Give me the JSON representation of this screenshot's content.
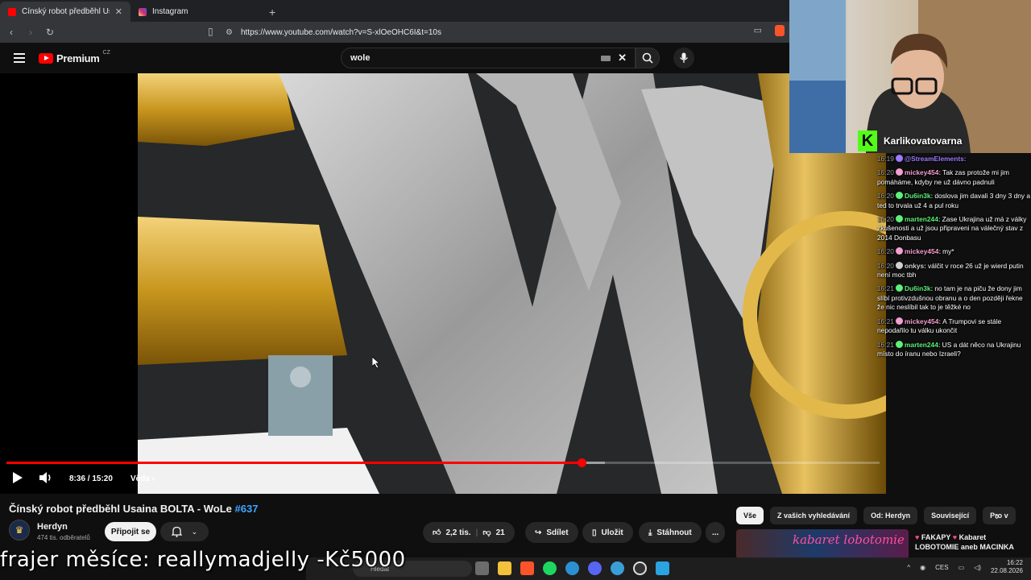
{
  "browser": {
    "tabs": [
      {
        "title": "Čínský robot předběhl Usaina BO",
        "active": true,
        "favicon_color": "#ff0000"
      },
      {
        "title": "Instagram",
        "active": false,
        "favicon_color": "#d62976"
      }
    ],
    "new_tab": "+",
    "url": "https://www.youtube.com/watch?v=S-xlOeOHC6I&t=10s"
  },
  "youtube": {
    "logo_text": "Premium",
    "logo_region": "CZ",
    "search_value": "wole"
  },
  "player": {
    "time": "8:36 / 15:20",
    "chapter": "Věda",
    "progress_fraction": 0.659,
    "buffered_fraction": 0.685,
    "autoplay_on": true
  },
  "video": {
    "title": "Čínský robot předběhl Usaina BOLTA - WoLe",
    "hashtag": "#637",
    "channel_name": "Herdyn",
    "subscribers": "474 tis. odběratelů",
    "join_label": "Připojit se",
    "likes": "2,2 tis.",
    "dislikes": "21",
    "share_label": "Sdílet",
    "save_label": "Uložit",
    "download_label": "Stáhnout",
    "more_label": "..."
  },
  "chips": [
    "Vše",
    "Z vašich vyhledávání",
    "Od: Herdyn",
    "Související",
    "Pro v"
  ],
  "recommendation": {
    "thumb_text": "kabaret lobotomie",
    "title_a": "FAKAPY",
    "title_b": "Kabaret LOBOTOMIE aneb MACINKA"
  },
  "overlay": {
    "donor_text": "frajer měsíce: reallymadjelly -Kč5000"
  },
  "taskbar": {
    "search_placeholder": "Hledat",
    "lang": "CES",
    "time": "16:22",
    "date": "22.08.2026"
  },
  "stream": {
    "streamer": "Karlikovatovarna"
  },
  "chat": [
    {
      "ts": "16:19",
      "user": "@StreamElements:",
      "color": "#9b7bff",
      "text": ""
    },
    {
      "ts": "16:20",
      "user": "mickey454:",
      "color": "#f2a0d0",
      "text": "Tak zas protože mi jim pomáháme, kdyby ne už dávno padnuli"
    },
    {
      "ts": "16:20",
      "user": "Du6in3k:",
      "color": "#5ef07a",
      "text": "doslova jim davali 3 dny 3 dny a ted to trvala už 4 a pul roku"
    },
    {
      "ts": "16:20",
      "user": "marten244:",
      "color": "#5ef07a",
      "text": "Zase Ukrajina už má z války zkušenosti a už jsou připraveni na válečný stav z 2014 Donbasu"
    },
    {
      "ts": "16:20",
      "user": "mickey454:",
      "color": "#f2a0d0",
      "text": "my*"
    },
    {
      "ts": "16:20",
      "user": "onkys:",
      "color": "#d0d0d0",
      "text": "válčit v roce 26 už je wierd putin není moc tbh"
    },
    {
      "ts": "16:21",
      "user": "Du6in3k:",
      "color": "#5ef07a",
      "text": "no tam je na piču že dony jim slíbí protivzdušnou obranu a o den později řekne že nic neslíbil tak to je těžké no"
    },
    {
      "ts": "16:21",
      "user": "mickey454:",
      "color": "#f2a0d0",
      "text": "A Trumpovi se stále nepodařilo tu válku ukončit"
    },
    {
      "ts": "16:21",
      "user": "marten244:",
      "color": "#5ef07a",
      "text": "US a dát něco na Ukrajinu místo do íranu nebo Izraeli?"
    }
  ]
}
